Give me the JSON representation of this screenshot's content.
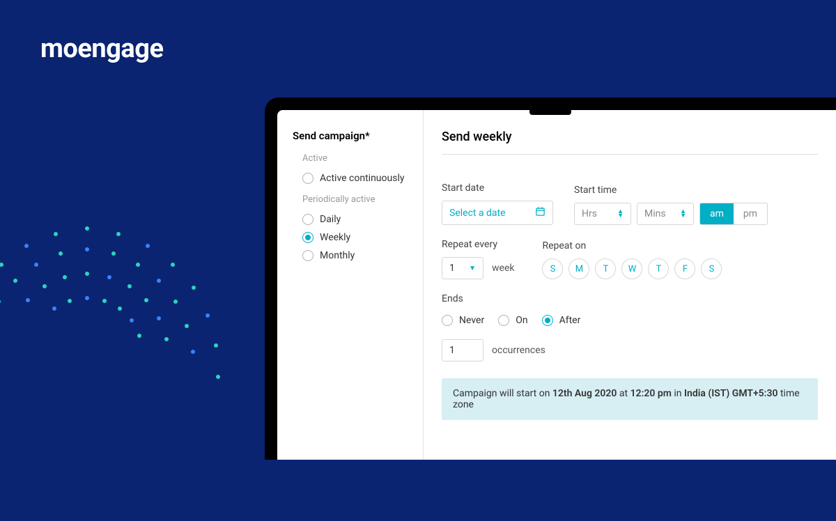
{
  "brand": "moengage",
  "sidebar": {
    "title": "Send campaign*",
    "group_active": "Active",
    "group_periodic": "Periodically active",
    "options": {
      "active_cont": "Active continuously",
      "daily": "Daily",
      "weekly": "Weekly",
      "monthly": "Monthly"
    },
    "selected": "weekly"
  },
  "main": {
    "title": "Send weekly",
    "start_date_label": "Start date",
    "start_date_placeholder": "Select a date",
    "start_time_label": "Start time",
    "hrs_placeholder": "Hrs",
    "mins_placeholder": "Mins",
    "am": "am",
    "pm": "pm",
    "ampm_selected": "am",
    "repeat_every_label": "Repeat every",
    "repeat_every_value": "1",
    "repeat_every_unit": "week",
    "repeat_on_label": "Repeat on",
    "days": [
      "S",
      "M",
      "T",
      "W",
      "T",
      "F",
      "S"
    ],
    "ends_label": "Ends",
    "ends_options": {
      "never": "Never",
      "on": "On",
      "after": "After"
    },
    "ends_selected": "after",
    "occurrences_value": "1",
    "occurrences_label": "occurrences",
    "banner_prefix": "Campaign will start on ",
    "banner_date": "12th Aug 2020",
    "banner_at": " at ",
    "banner_time": "12:20 pm",
    "banner_in": " in ",
    "banner_tz": "India (IST) GMT+5:30",
    "banner_suffix": " time zone"
  }
}
